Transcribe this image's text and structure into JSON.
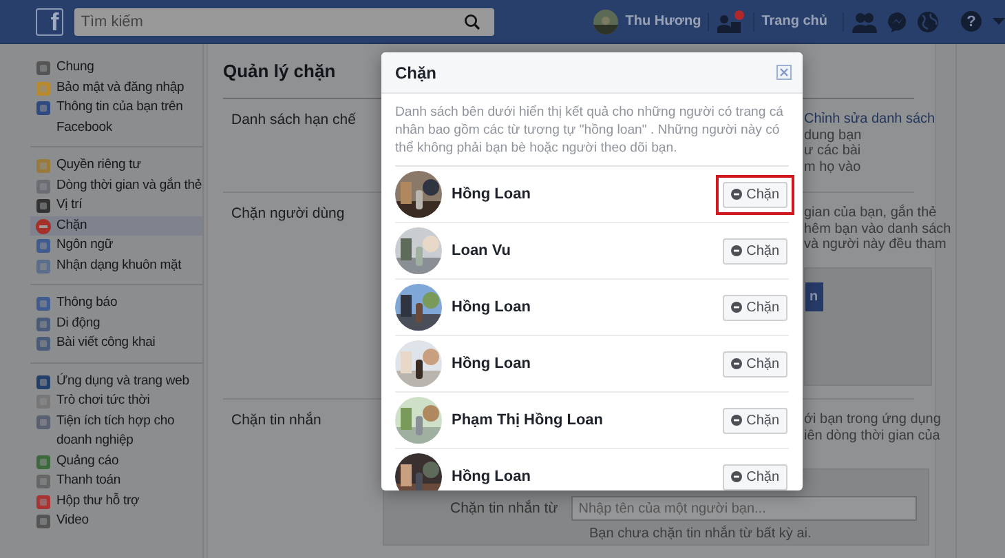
{
  "topbar": {
    "logo": "f",
    "search": {
      "placeholder": "Tìm kiếm"
    },
    "user": {
      "name": "Thu Hương"
    },
    "friend_request_badge": true,
    "home": "Trang chủ",
    "help": "?"
  },
  "sidebar": {
    "groups": [
      {
        "items": [
          {
            "label": "Chung",
            "selected": false
          },
          {
            "label": "Bảo mật và đăng nhập",
            "selected": false
          },
          {
            "label": "Thông tin của bạn trên Facebook",
            "selected": false
          }
        ]
      },
      {
        "items": [
          {
            "label": "Quyền riêng tư",
            "selected": false
          },
          {
            "label": "Dòng thời gian và gắn thẻ",
            "selected": false
          },
          {
            "label": "Vị trí",
            "selected": false
          },
          {
            "label": "Chặn",
            "selected": true
          },
          {
            "label": "Ngôn ngữ",
            "selected": false
          },
          {
            "label": "Nhận dạng khuôn mặt",
            "selected": false
          }
        ]
      },
      {
        "items": [
          {
            "label": "Thông báo",
            "selected": false
          },
          {
            "label": "Di động",
            "selected": false
          },
          {
            "label": "Bài viết công khai",
            "selected": false
          }
        ]
      },
      {
        "items": [
          {
            "label": "Ứng dụng và trang web",
            "selected": false
          },
          {
            "label": "Trò chơi tức thời",
            "selected": false
          },
          {
            "label": "Tiện ích tích hợp cho doanh nghiệp",
            "selected": false
          },
          {
            "label": "Quảng cáo",
            "selected": false
          },
          {
            "label": "Thanh toán",
            "selected": false
          },
          {
            "label": "Hộp thư hỗ trợ",
            "selected": false
          },
          {
            "label": "Video",
            "selected": false
          }
        ]
      }
    ]
  },
  "main": {
    "title": "Quản lý chặn",
    "sections": [
      {
        "label": "Danh sách hạn chế",
        "link": "Chỉnh sửa danh sách",
        "text_fragments": [
          "dung bạn",
          "ư các bài",
          "m họ vào"
        ]
      },
      {
        "label": "Chặn người dùng",
        "text_fragments": [
          "gian của bạn, gắn thẻ",
          "hêm bạn vào danh sách",
          "và người này đều tham"
        ],
        "button_fragment": "n"
      },
      {
        "label": "Chặn tin nhắn",
        "text_fragments": [
          "ới bạn trong ứng dụng",
          "iên dòng thời gian của"
        ],
        "field_label": "Chặn tin nhắn từ",
        "field_placeholder": "Nhập tên của một người bạn...",
        "note": "Bạn chưa chặn tin nhắn từ bất kỳ ai."
      }
    ]
  },
  "dialog": {
    "title": "Chặn",
    "description": "Danh sách bên dưới hiển thị kết quả cho những người có trang cá nhân bao gồm các từ tương tự \"hồng loan\" . Những người này có thể không phải bạn bè hoặc người theo dõi bạn.",
    "results": [
      {
        "name": "Hồng Loan",
        "button": "Chặn",
        "highlighted": true
      },
      {
        "name": "Loan Vu",
        "button": "Chặn",
        "highlighted": false
      },
      {
        "name": "Hồng Loan",
        "button": "Chặn",
        "highlighted": false
      },
      {
        "name": "Hồng Loan",
        "button": "Chặn",
        "highlighted": false
      },
      {
        "name": "Phạm Thị Hồng Loan",
        "button": "Chặn",
        "highlighted": false
      },
      {
        "name": "Hồng Loan",
        "button": "Chặn",
        "highlighted": false
      }
    ]
  }
}
